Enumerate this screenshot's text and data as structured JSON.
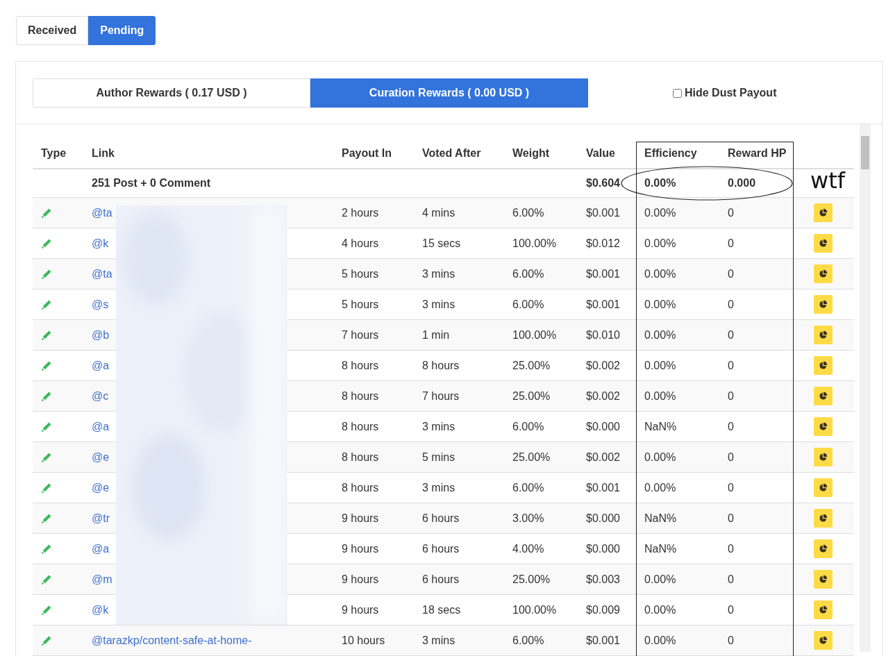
{
  "view_tabs": [
    {
      "label": "Received",
      "selected": false
    },
    {
      "label": "Pending",
      "selected": true
    }
  ],
  "reward_tabs": [
    {
      "label": "Author Rewards ( 0.17 USD )",
      "selected": false
    },
    {
      "label": "Curation Rewards ( 0.00 USD )",
      "selected": true
    }
  ],
  "hide_dust": {
    "label": "Hide Dust Payout",
    "checked": false
  },
  "table": {
    "columns": [
      "Type",
      "Link",
      "Payout In",
      "Voted After",
      "Weight",
      "Value",
      "Efficiency",
      "Reward HP"
    ],
    "summary": {
      "link": "251 Post + 0 Comment",
      "value": "$0.604",
      "efficiency": "0.00%",
      "reward_hp": "0.000"
    },
    "rows": [
      {
        "link": "@ta",
        "payout_in": "2 hours",
        "voted_after": "4 mins",
        "weight": "6.00%",
        "value": "$0.001",
        "efficiency": "0.00%",
        "reward_hp": "0"
      },
      {
        "link": "@k",
        "payout_in": "4 hours",
        "voted_after": "15 secs",
        "weight": "100.00%",
        "value": "$0.012",
        "efficiency": "0.00%",
        "reward_hp": "0"
      },
      {
        "link": "@ta",
        "payout_in": "5 hours",
        "voted_after": "3 mins",
        "weight": "6.00%",
        "value": "$0.001",
        "efficiency": "0.00%",
        "reward_hp": "0"
      },
      {
        "link": "@s",
        "payout_in": "5 hours",
        "voted_after": "3 mins",
        "weight": "6.00%",
        "value": "$0.001",
        "efficiency": "0.00%",
        "reward_hp": "0"
      },
      {
        "link": "@b",
        "payout_in": "7 hours",
        "voted_after": "1 min",
        "weight": "100.00%",
        "value": "$0.010",
        "efficiency": "0.00%",
        "reward_hp": "0"
      },
      {
        "link": "@a",
        "payout_in": "8 hours",
        "voted_after": "8 hours",
        "weight": "25.00%",
        "value": "$0.002",
        "efficiency": "0.00%",
        "reward_hp": "0"
      },
      {
        "link": "@c",
        "payout_in": "8 hours",
        "voted_after": "7 hours",
        "weight": "25.00%",
        "value": "$0.002",
        "efficiency": "0.00%",
        "reward_hp": "0"
      },
      {
        "link": "@a",
        "payout_in": "8 hours",
        "voted_after": "3 mins",
        "weight": "6.00%",
        "value": "$0.000",
        "efficiency": "NaN%",
        "reward_hp": "0"
      },
      {
        "link": "@e",
        "payout_in": "8 hours",
        "voted_after": "5 mins",
        "weight": "25.00%",
        "value": "$0.002",
        "efficiency": "0.00%",
        "reward_hp": "0"
      },
      {
        "link": "@e",
        "payout_in": "8 hours",
        "voted_after": "3 mins",
        "weight": "6.00%",
        "value": "$0.001",
        "efficiency": "0.00%",
        "reward_hp": "0"
      },
      {
        "link": "@tr",
        "payout_in": "9 hours",
        "voted_after": "6 hours",
        "weight": "3.00%",
        "value": "$0.000",
        "efficiency": "NaN%",
        "reward_hp": "0"
      },
      {
        "link": "@a",
        "payout_in": "9 hours",
        "voted_after": "6 hours",
        "weight": "4.00%",
        "value": "$0.000",
        "efficiency": "NaN%",
        "reward_hp": "0"
      },
      {
        "link": "@m",
        "payout_in": "9 hours",
        "voted_after": "6 hours",
        "weight": "25.00%",
        "value": "$0.003",
        "efficiency": "0.00%",
        "reward_hp": "0"
      },
      {
        "link": "@k",
        "payout_in": "9 hours",
        "voted_after": "18 secs",
        "weight": "100.00%",
        "value": "$0.009",
        "efficiency": "0.00%",
        "reward_hp": "0"
      },
      {
        "link": "@tarazkp/content-safe-at-home-",
        "payout_in": "10 hours",
        "voted_after": "3 mins",
        "weight": "6.00%",
        "value": "$0.001",
        "efficiency": "0.00%",
        "reward_hp": "0"
      }
    ]
  },
  "annotation": {
    "note": "wtf"
  }
}
